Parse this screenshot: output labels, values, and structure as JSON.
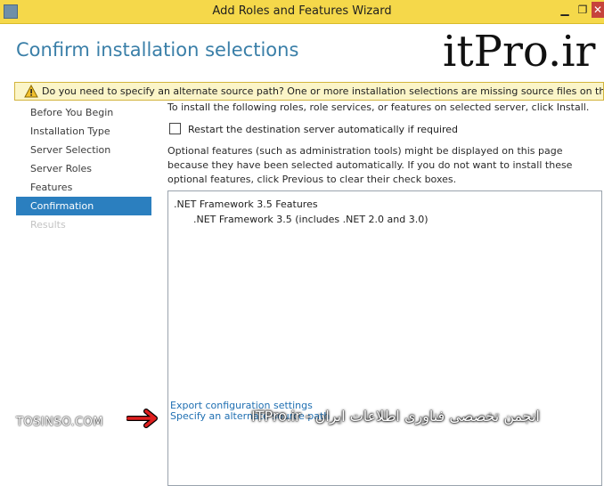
{
  "window": {
    "title": "Add Roles and Features Wizard"
  },
  "header": {
    "page_title": "Confirm installation selections",
    "brand": "itPro.ir"
  },
  "warning": {
    "text": "Do you need to specify an alternate source path? One or more installation selections are missing source files on the destination...",
    "close_label": "×"
  },
  "sidebar": {
    "items": [
      {
        "label": "Before You Begin",
        "state": "normal"
      },
      {
        "label": "Installation Type",
        "state": "normal"
      },
      {
        "label": "Server Selection",
        "state": "normal"
      },
      {
        "label": "Server Roles",
        "state": "normal"
      },
      {
        "label": "Features",
        "state": "normal"
      },
      {
        "label": "Confirmation",
        "state": "active"
      },
      {
        "label": "Results",
        "state": "disabled"
      }
    ]
  },
  "main": {
    "intro": "To install the following roles, role services, or features on selected server, click Install.",
    "restart_checkbox": {
      "label": "Restart the destination server automatically if required",
      "checked": false
    },
    "optional_text": "Optional features (such as administration tools) might be displayed on this page because they have been selected automatically. If you do not want to install these optional features, click Previous to clear their check boxes.",
    "features": [
      {
        "label": ".NET Framework 3.5 Features",
        "level": 1
      },
      {
        "label": ".NET Framework 3.5 (includes .NET 2.0 and 3.0)",
        "level": 2
      }
    ],
    "export_link": "Export configuration settings",
    "alternate_link": "Specify an alternate source path"
  },
  "watermarks": {
    "left": "TOSINSO.COM",
    "right": "انجمن تخصصی فناوری اطلاعات ایران - ITPro.ir"
  },
  "colors": {
    "titlebar": "#f5d84a",
    "accent": "#2b7fbf",
    "page_title": "#3a7fa8",
    "link": "#1f6fb2",
    "warning_bg": "#fbf5c8"
  }
}
